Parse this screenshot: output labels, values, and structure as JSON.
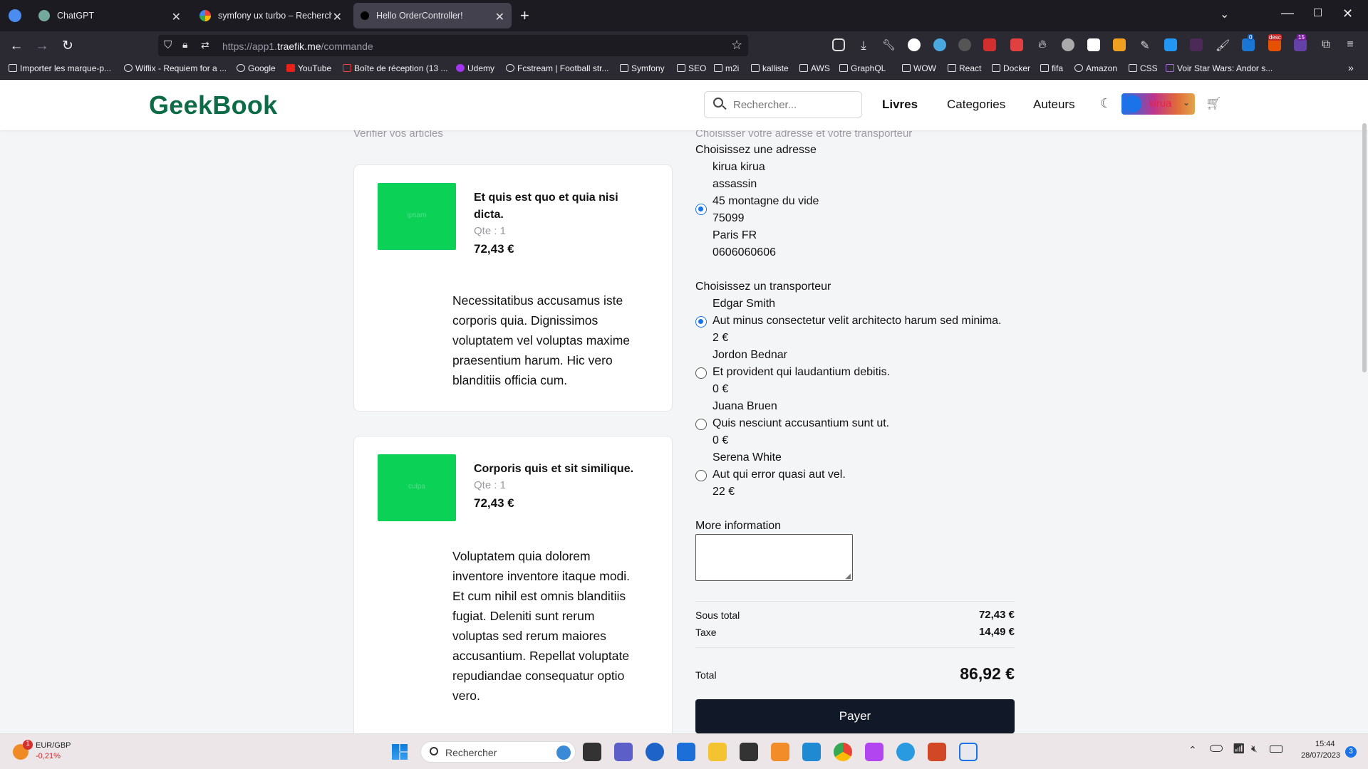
{
  "browser": {
    "tabs": [
      {
        "label": "ChatGPT",
        "active": false
      },
      {
        "label": "symfony ux turbo – Recherche",
        "active": false
      },
      {
        "label": "Hello OrderController!",
        "active": true
      }
    ],
    "url_prefix": "https://app1.",
    "url_domain": "traefik.me",
    "url_path": "/commande",
    "ext_badges": {
      "notif": "0",
      "desc": "desc",
      "twitch": "15"
    },
    "bookmarks": [
      "Importer les marque-p...",
      "Wiflix - Requiem for a ...",
      "Google",
      "YouTube",
      "Boîte de réception (13 ...",
      "Udemy",
      "Fcstream | Football str...",
      "Symfony",
      "SEO",
      "m2i",
      "kalliste",
      "AWS",
      "GraphQL",
      "WOW",
      "React",
      "Docker",
      "fifa",
      "Amazon",
      "CSS",
      "Voir Star Wars: Andor s..."
    ]
  },
  "header": {
    "logo": "GeekBook",
    "search_placeholder": "Rechercher...",
    "nav": [
      "Livres",
      "Categories",
      "Auteurs"
    ],
    "user": "kirua"
  },
  "cart": {
    "caption": "Verifier vos articles",
    "items": [
      {
        "thumb_text": "ipsam",
        "title_line1": "Et quis est quo et quia nisi",
        "title_line2": "dicta.",
        "qty": "Qte : 1",
        "price": "72,43 €",
        "desc": [
          "Necessitatibus accusamus iste",
          "corporis quia. Dignissimos",
          "voluptatem vel voluptas maxime",
          "praesentium harum. Hic vero",
          "blanditiis officia cum."
        ]
      },
      {
        "thumb_text": "culpa",
        "title_line1": "Corporis quis et sit similique.",
        "title_line2": "",
        "qty": "Qte : 1",
        "price": "72,43 €",
        "desc": [
          "Voluptatem quia dolorem",
          "inventore inventore itaque modi.",
          "Et cum nihil est omnis blanditiis",
          "fugiat. Deleniti sunt rerum",
          "voluptas sed rerum maiores",
          "accusantium. Repellat voluptate",
          "repudiandae consequatur optio",
          "vero."
        ]
      }
    ]
  },
  "checkout": {
    "caption": "Choisisser votre adresse et votre transporteur",
    "address_heading": "Choisissez une adresse",
    "address": [
      "kirua kirua",
      "assassin",
      "45 montagne du vide",
      "75099",
      "Paris FR",
      "0606060606"
    ],
    "address_selected": true,
    "carrier_heading": "Choisissez un transporteur",
    "carriers": [
      {
        "name": "Edgar Smith",
        "desc": "Aut minus consectetur velit architecto harum sed minima.",
        "price": "2 €",
        "selected": true
      },
      {
        "name": "Jordon Bednar",
        "desc": "Et provident qui laudantium debitis.",
        "price": "0 €",
        "selected": false
      },
      {
        "name": "Juana Bruen",
        "desc": "Quis nesciunt accusantium sunt ut.",
        "price": "0 €",
        "selected": false
      },
      {
        "name": "Serena White",
        "desc": "Aut qui error quasi aut vel.",
        "price": "22 €",
        "selected": false
      }
    ],
    "more_info_label": "More information",
    "subtotal_label": "Sous total",
    "subtotal": "72,43 €",
    "tax_label": "Taxe",
    "tax": "14,49 €",
    "total_label": "Total",
    "total": "86,92 €",
    "pay_label": "Payer"
  },
  "taskbar": {
    "widget_title": "EUR/GBP",
    "widget_value": "-0,21%",
    "widget_badge": "1",
    "search": "Rechercher",
    "time": "15:44",
    "date": "28/07/2023",
    "notif_count": "3"
  }
}
